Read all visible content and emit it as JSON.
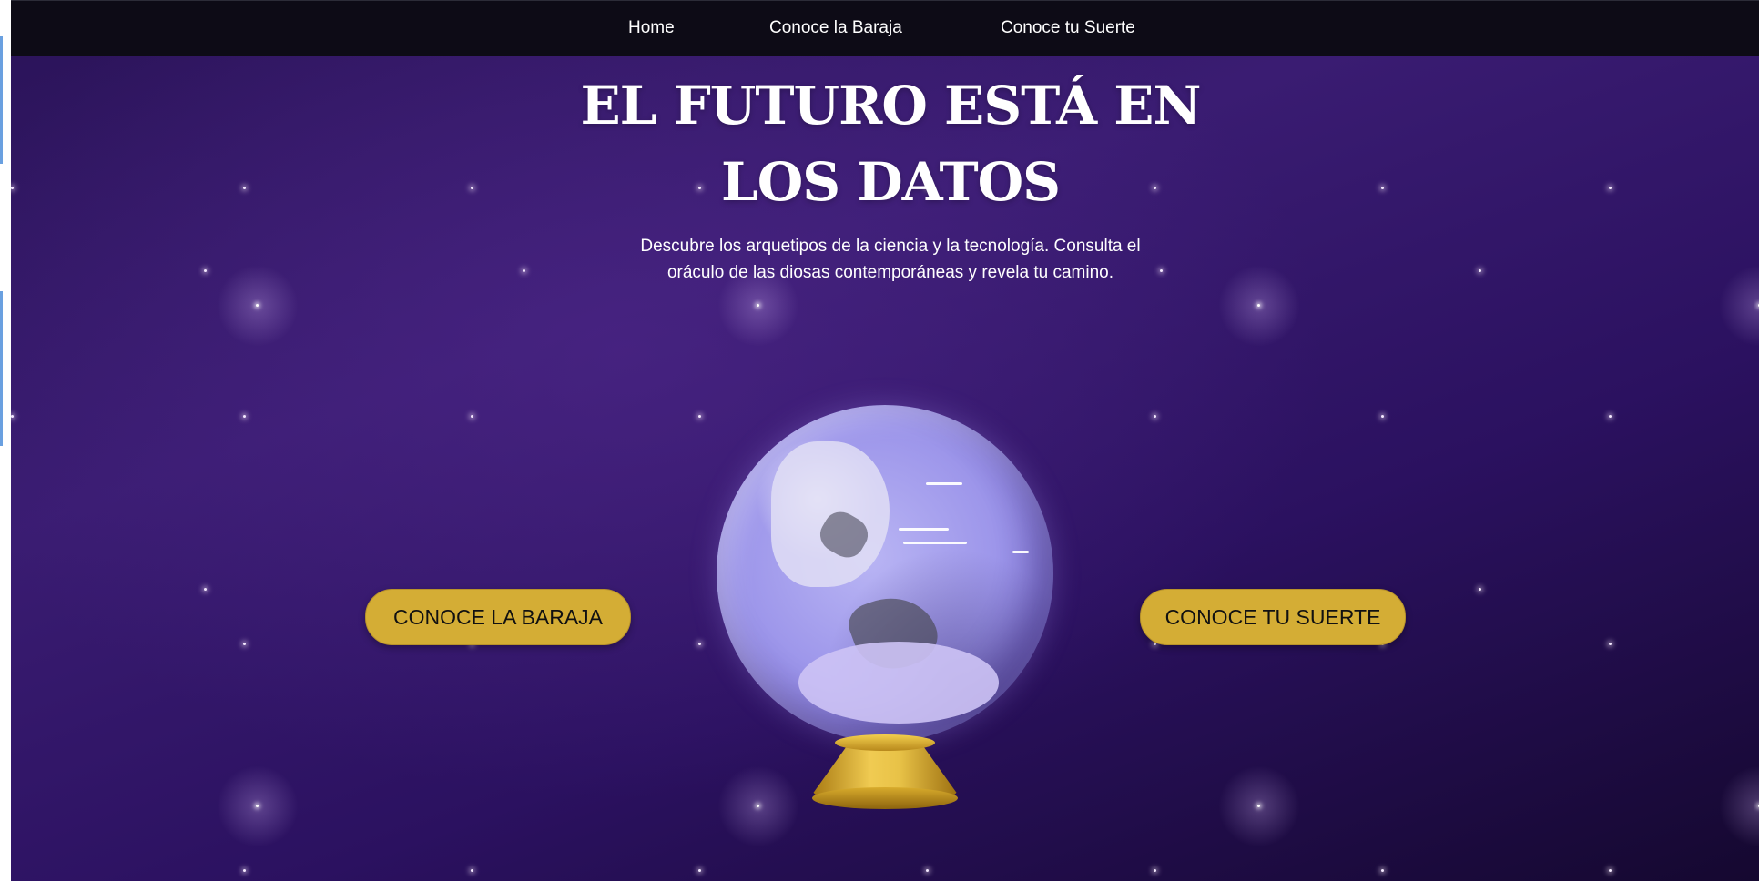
{
  "nav": {
    "items": [
      {
        "label": "Home"
      },
      {
        "label": "Conoce la Baraja"
      },
      {
        "label": "Conoce tu Suerte"
      }
    ]
  },
  "hero": {
    "title_line1": "EL FUTURO ESTÁ EN",
    "title_line2": "LOS DATOS",
    "subtitle_line1": "Descubre los arquetipos de la ciencia y la tecnología. Consulta el",
    "subtitle_line2": "oráculo de las diosas contemporáneas y revela tu camino."
  },
  "cta": {
    "baraja_label": "CONOCE LA BARAJA",
    "suerte_label": "CONOCE TU SUERTE"
  },
  "colors": {
    "background": "#2b1160",
    "navbar": "#0d0b16",
    "button": "#d4ad35",
    "orb": "#9c95ea",
    "stand": "#d8ab2c"
  },
  "icons": {
    "orb": "crystal-ball-icon"
  }
}
